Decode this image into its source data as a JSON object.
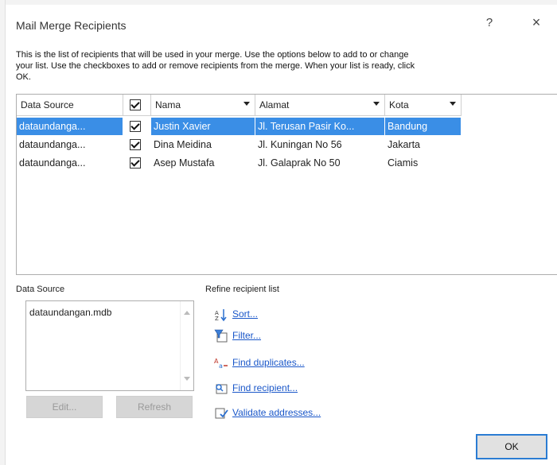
{
  "dialog": {
    "title": "Mail Merge Recipients",
    "help": "?",
    "close": "×",
    "instructions": "This is the list of recipients that will be used in your merge.  Use the options below to add to or change\nyour list.  Use the checkboxes to add or remove recipients from the merge.  When your list is ready, click\nOK."
  },
  "table": {
    "columns": [
      "Data Source",
      "",
      "Nama",
      "Alamat",
      "Kota"
    ],
    "rows": [
      {
        "source": "dataundanga...",
        "checked": true,
        "nama": "Justin Xavier",
        "alamat": "Jl. Terusan Pasir Ko...",
        "kota": "Bandung",
        "selected": true
      },
      {
        "source": "dataundanga...",
        "checked": true,
        "nama": "Dina Meidina",
        "alamat": "Jl. Kuningan No 56",
        "kota": "Jakarta",
        "selected": false
      },
      {
        "source": "dataundanga...",
        "checked": true,
        "nama": "Asep Mustafa",
        "alamat": "Jl. Galaprak No 50",
        "kota": "Ciamis",
        "selected": false
      }
    ]
  },
  "data_source": {
    "label": "Data Source",
    "items": [
      "dataundangan.mdb"
    ],
    "edit_label": "Edit...",
    "refresh_label": "Refresh"
  },
  "refine": {
    "label": "Refine recipient list",
    "links": [
      {
        "label": "Sort...",
        "icon": "sort-icon"
      },
      {
        "label": "Filter...",
        "icon": "filter-icon"
      },
      {
        "label": "Find duplicates...",
        "icon": "find-duplicates-icon"
      },
      {
        "label": "Find recipient...",
        "icon": "find-recipient-icon"
      },
      {
        "label": "Validate addresses...",
        "icon": "validate-addresses-icon"
      }
    ]
  },
  "ok_label": "OK",
  "colors": {
    "selection": "#3a8ee6",
    "link": "#1a57c9",
    "ok_border": "#2b7cd3"
  }
}
